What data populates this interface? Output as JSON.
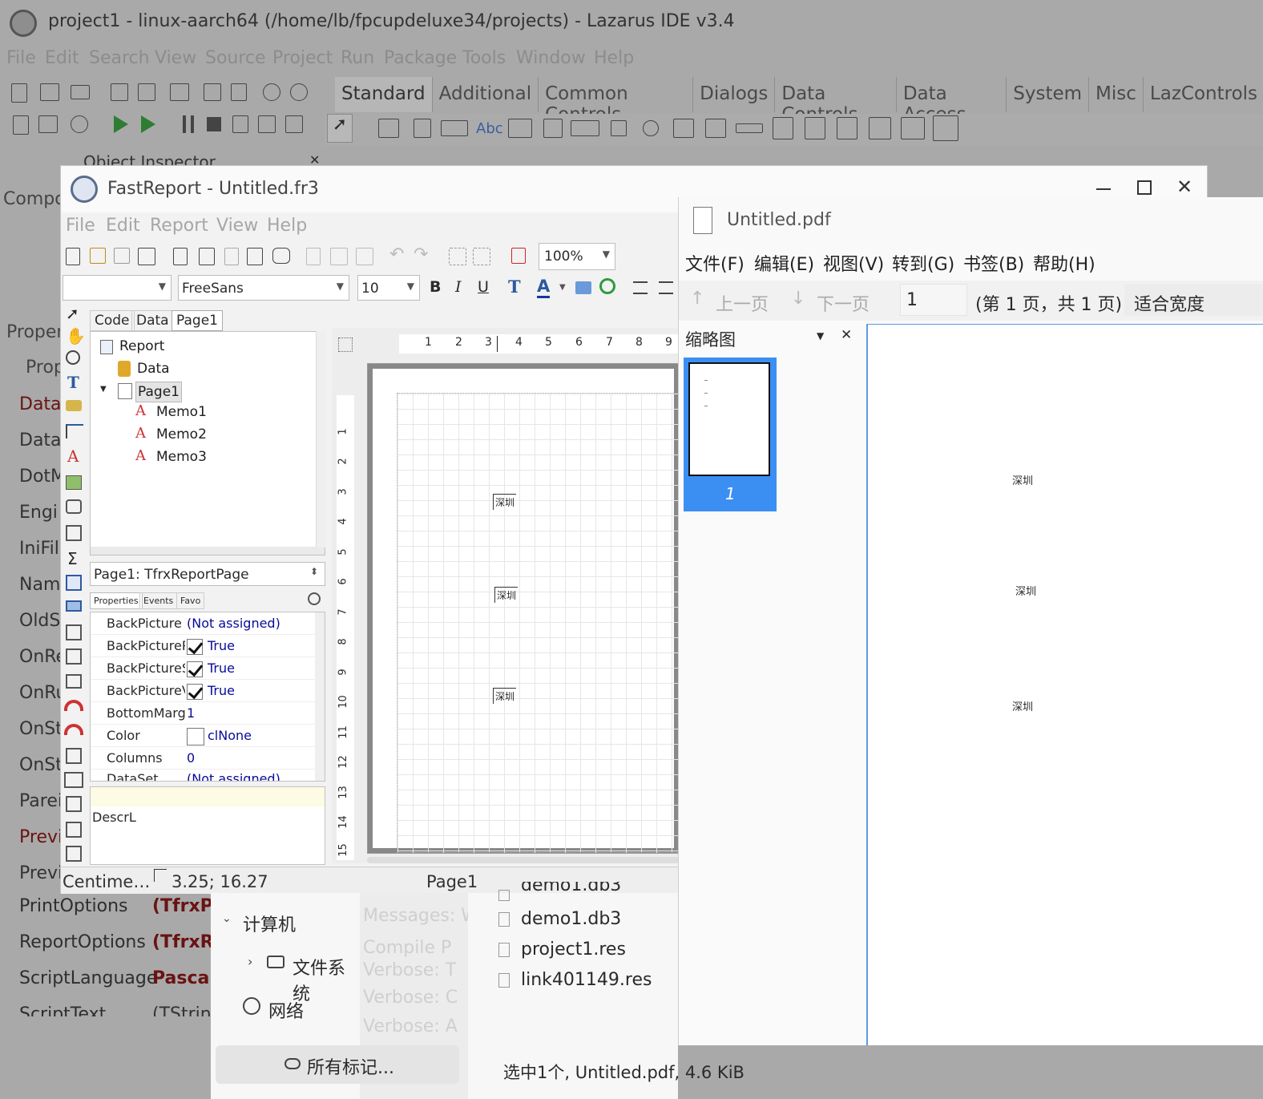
{
  "lazarus": {
    "title": "project1 - linux-aarch64 (/home/lb/fpcupdeluxe34/projects) - Lazarus IDE v3.4",
    "menu": [
      "File",
      "Edit",
      "Search",
      "View",
      "Source",
      "Project",
      "Run",
      "Package",
      "Tools",
      "Window",
      "Help"
    ],
    "palette_tabs": [
      "Standard",
      "Additional",
      "Common Controls",
      "Dialogs",
      "Data Controls",
      "Data Access",
      "System",
      "Misc",
      "LazControls"
    ],
    "palette_selected": "Standard",
    "object_inspector_title": "Object Inspector",
    "components_label": "Compo",
    "properties_label": "Proper",
    "prop_tab": "Prop",
    "oi_rows": [
      "Data:",
      "Data:",
      "DotM",
      "Engi",
      "IniFil",
      "Nam",
      "OldS",
      "OnRe",
      "OnRu",
      "OnSt",
      "OnSt",
      "Parei",
      "Previ",
      "Previ"
    ],
    "oi_lower_rows": [
      {
        "name": "PrintOptions",
        "value": "(TfrxPrintOptions)"
      },
      {
        "name": "ReportOptions",
        "value": "(TfrxReportOptions)"
      },
      {
        "name": "ScriptLanguage",
        "value": "PascalScript"
      },
      {
        "name": "ScriptText",
        "value": "(TStrings)"
      }
    ]
  },
  "fastreport": {
    "title": "FastReport - Untitled.fr3",
    "menu": [
      "File",
      "Edit",
      "Report",
      "View",
      "Help"
    ],
    "zoom": "100%",
    "font_name": "FreeSans",
    "font_size": "10",
    "tabs": [
      "Code",
      "Data",
      "Page1"
    ],
    "tree": {
      "root": "Report",
      "items": [
        "Data",
        "Page1",
        "Memo1",
        "Memo2",
        "Memo3"
      ]
    },
    "object_selector": "Page1: TfrxReportPage",
    "insp_tabs": [
      "Properties",
      "Events",
      "Favo"
    ],
    "properties": [
      {
        "name": "BackPicture",
        "value": "(Not assigned)",
        "check": false
      },
      {
        "name": "BackPicturePrintable",
        "value": "True",
        "check": true
      },
      {
        "name": "BackPictureStretched",
        "value": "True",
        "check": true
      },
      {
        "name": "BackPictureVisible",
        "value": "True",
        "check": true
      },
      {
        "name": "BottomMargin",
        "value": "1",
        "check": false
      },
      {
        "name": "Color",
        "value": "clNone",
        "check": false
      },
      {
        "name": "Columns",
        "value": "0",
        "check": false
      },
      {
        "name": "DataSet",
        "value": "(Not assigned)",
        "check": false
      }
    ],
    "desc_label": "DescrL",
    "ruler_h": [
      "1",
      "2",
      "3",
      "4",
      "5",
      "6",
      "7",
      "8",
      "9"
    ],
    "ruler_v": [
      "1",
      "2",
      "3",
      "4",
      "5",
      "6",
      "7",
      "8",
      "9",
      "10",
      "11",
      "12",
      "13",
      "14",
      "15"
    ],
    "memos": [
      "深圳",
      "深圳",
      "深圳"
    ],
    "status_units": "Centime…",
    "status_coords": "3.25; 16.27",
    "status_page": "Page1"
  },
  "pdf": {
    "title": "Untitled.pdf",
    "menu": [
      "文件(F)",
      "编辑(E)",
      "视图(V)",
      "转到(G)",
      "书签(B)",
      "帮助(H)"
    ],
    "prev": "上一页",
    "next": "下一页",
    "page_num": "1",
    "page_info": "(第 1 页，共 1 页)",
    "fit": "适合宽度",
    "thumb_panel": "缩略图",
    "thumb_label": "1",
    "content": [
      "深圳",
      "深圳",
      "深圳"
    ]
  },
  "filemanager": {
    "tree": [
      {
        "label": "计算机"
      },
      {
        "label": "文件系统"
      },
      {
        "label": "网络"
      }
    ],
    "tags_button": "所有标记...",
    "files": [
      "demo1.db3",
      "project1.res",
      "link401149.res"
    ],
    "partial_file": "demo1.db3",
    "messages": [
      "Messages: W",
      "Compile P",
      "Verbose: T",
      "Verbose: C",
      "Verbose: A"
    ],
    "status": "选中1个, Untitled.pdf, 4.6 KiB"
  }
}
